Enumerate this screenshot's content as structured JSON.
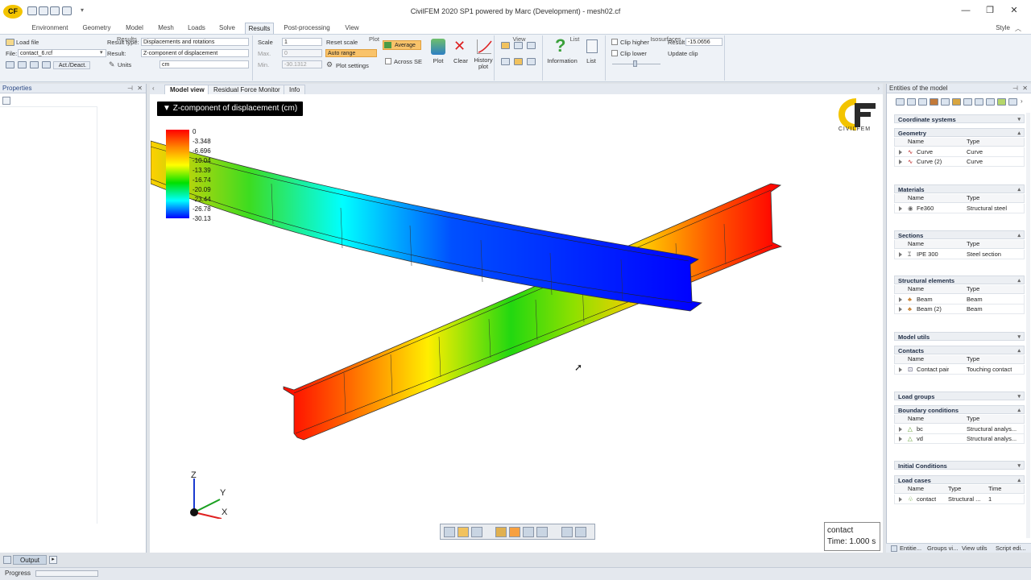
{
  "window": {
    "title": "CivilFEM 2020 SP1 powered by Marc (Development) - mesh02.cf",
    "style_label": "Style"
  },
  "app_logo": "CF",
  "menu": [
    "Environment",
    "Geometry",
    "Model",
    "Mesh",
    "Loads",
    "Solve",
    "Results",
    "Post-processing",
    "View"
  ],
  "active_menu": "Results",
  "ribbon": {
    "results_group": {
      "load_file": "Load file",
      "file_label": "File:",
      "file_value": "contact_6.rcf",
      "act_deact": "Act./Deact.",
      "result_type_label": "Result type:",
      "result_type_value": "Displacements and rotations",
      "result_label": "Result:",
      "result_value": "Z-component of displacement",
      "units_label": "Units",
      "units_value": "cm",
      "group_label": "Results"
    },
    "plot_group": {
      "scale_label": "Scale",
      "scale_value": "1",
      "reset_scale": "Reset scale",
      "max_label": "Max.",
      "max_value": "0",
      "auto_range": "Auto range",
      "min_label": "Min.",
      "min_value": "-30.1312",
      "plot_settings": "Plot settings",
      "average": "Average",
      "across_se": "Across SE",
      "plot_btn": "Plot",
      "clear_btn": "Clear",
      "history_btn": "History plot",
      "group_label": "Plot"
    },
    "view_group": {
      "group_label": "View"
    },
    "list_group": {
      "information": "Information",
      "list": "List",
      "group_label": "List"
    },
    "iso_group": {
      "clip_higher": "Clip higher",
      "clip_lower": "Clip lower",
      "result_label": "Result",
      "result_value": "-15.0656",
      "update_clip": "Update clip",
      "group_label": "Isosurfaces"
    }
  },
  "properties_panel": {
    "title": "Properties"
  },
  "viewport": {
    "tabs": [
      "Model view",
      "Residual Force Monitor",
      "Info"
    ],
    "active_tab": "Model view",
    "plot_title": "Z-component of displacement (cm)",
    "legend_values": [
      "0",
      "-3.348",
      "-6.696",
      "-10.04",
      "-13.39",
      "-16.74",
      "-20.09",
      "-23.44",
      "-26.78",
      "-30.13"
    ],
    "axes": {
      "z": "Z",
      "y": "Y",
      "x": "X"
    },
    "logo_text": "CIVILFEM",
    "contact_box": {
      "name": "contact",
      "time": "Time: 1.000 s"
    }
  },
  "entities_panel": {
    "title": "Entities of the model",
    "sections": {
      "coord": "Coordinate systems",
      "geometry": {
        "title": "Geometry",
        "col_name": "Name",
        "col_type": "Type",
        "rows": [
          [
            "Curve",
            "Curve"
          ],
          [
            "Curve (2)",
            "Curve"
          ]
        ]
      },
      "materials": {
        "title": "Materials",
        "col_name": "Name",
        "col_type": "Type",
        "rows": [
          [
            "Fe360",
            "Structural steel"
          ]
        ]
      },
      "sections": {
        "title": "Sections",
        "col_name": "Name",
        "col_type": "Type",
        "rows": [
          [
            "IPE 300",
            "Steel section"
          ]
        ]
      },
      "structural": {
        "title": "Structural elements",
        "col_name": "Name",
        "col_type": "Type",
        "rows": [
          [
            "Beam",
            "Beam"
          ],
          [
            "Beam (2)",
            "Beam"
          ]
        ]
      },
      "model_utils": "Model utils",
      "contacts": {
        "title": "Contacts",
        "col_name": "Name",
        "col_type": "Type",
        "rows": [
          [
            "Contact pair",
            "Touching contact"
          ]
        ]
      },
      "load_groups": "Load groups",
      "boundary": {
        "title": "Boundary conditions",
        "col_name": "Name",
        "col_type": "Type",
        "rows": [
          [
            "bc",
            "Structural analys..."
          ],
          [
            "vd",
            "Structural analys..."
          ]
        ]
      },
      "initial": "Initial Conditions",
      "load_cases": {
        "title": "Load cases",
        "col_name": "Name",
        "col_type": "Type",
        "col_time": "Time",
        "rows": [
          [
            "contact",
            "Structural ...",
            "1"
          ]
        ]
      }
    },
    "bottom_tabs": [
      "Entitie...",
      "Groups vi...",
      "View utils",
      "Script edi..."
    ]
  },
  "output_tab": "Output",
  "status": {
    "progress_label": "Progress"
  }
}
